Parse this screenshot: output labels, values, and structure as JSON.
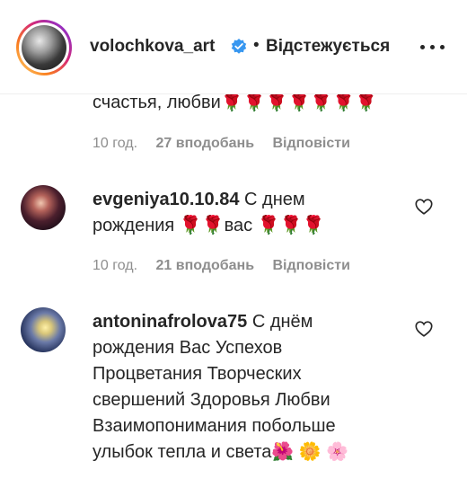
{
  "header": {
    "username": "volochkova_art",
    "dot": "•",
    "follow_status": "Відстежується"
  },
  "comments": [
    {
      "text": "счастья, любви🌹🌹🌹🌹🌹🌹🌹",
      "time": "10 год.",
      "likes": "27 вподобань",
      "reply": "Відповісти"
    },
    {
      "username": "evgeniya10.10.84",
      "text_line1": "С днем",
      "text_line2": "рождения 🌹🌹вас 🌹🌹🌹",
      "time": "10 год.",
      "likes": "21 вподобань",
      "reply": "Відповісти"
    },
    {
      "username": "antoninafrolova75",
      "text_line1": "С днём",
      "text_line2": "рождения Вас Успехов",
      "text_line3": "Процветания Творческих",
      "text_line4": "свершений Здоровья Любви",
      "text_line5": "Взаимопонимания побольше",
      "text_line6": "улыбок тепла и света🌺 🌼 🌸"
    }
  ],
  "icons": {
    "verified": "verified-badge-icon",
    "more": "more-options-icon",
    "like": "heart-outline-icon"
  },
  "colors": {
    "text": "#262626",
    "meta": "#8e8e8e",
    "verified": "#3897f0"
  }
}
